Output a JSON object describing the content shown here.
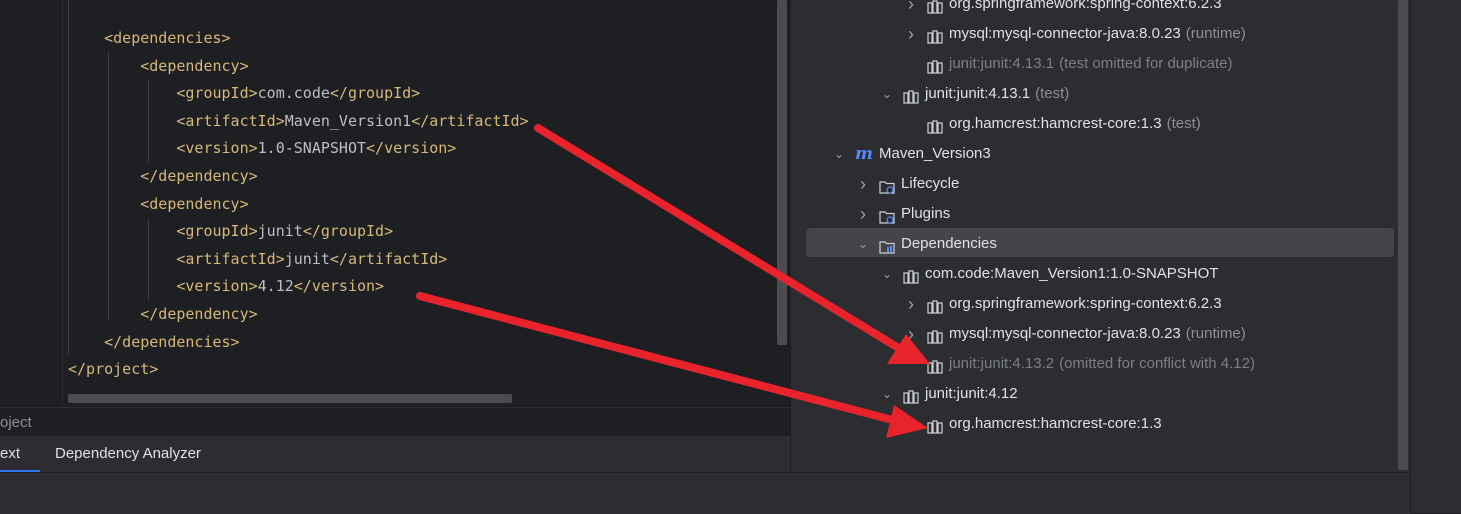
{
  "editor": {
    "lines": [
      {
        "indent": "    ",
        "parts": [
          [
            "tag",
            "<dependencies>"
          ]
        ]
      },
      {
        "indent": "        ",
        "parts": [
          [
            "tag",
            "<dependency>"
          ]
        ]
      },
      {
        "indent": "            ",
        "parts": [
          [
            "tag",
            "<groupId>"
          ],
          [
            "txt",
            "com.code"
          ],
          [
            "tag",
            "</groupId>"
          ]
        ]
      },
      {
        "indent": "            ",
        "parts": [
          [
            "tag",
            "<artifactId>"
          ],
          [
            "txt",
            "Maven_Version1"
          ],
          [
            "tag",
            "</artifactId>"
          ]
        ]
      },
      {
        "indent": "            ",
        "parts": [
          [
            "tag",
            "<version>"
          ],
          [
            "txt",
            "1.0-SNAPSHOT"
          ],
          [
            "tag",
            "</version>"
          ]
        ]
      },
      {
        "indent": "        ",
        "parts": [
          [
            "tag",
            "</dependency>"
          ]
        ]
      },
      {
        "indent": "        ",
        "parts": [
          [
            "tag",
            "<dependency>"
          ]
        ]
      },
      {
        "indent": "            ",
        "parts": [
          [
            "tag",
            "<groupId>"
          ],
          [
            "txt",
            "junit"
          ],
          [
            "tag",
            "</groupId>"
          ]
        ]
      },
      {
        "indent": "            ",
        "parts": [
          [
            "tag",
            "<artifactId>"
          ],
          [
            "txt",
            "junit"
          ],
          [
            "tag",
            "</artifactId>"
          ]
        ]
      },
      {
        "indent": "            ",
        "parts": [
          [
            "tag",
            "<version>"
          ],
          [
            "txt",
            "4.12"
          ],
          [
            "tag",
            "</version>"
          ]
        ]
      },
      {
        "indent": "        ",
        "parts": [
          [
            "tag",
            "</dependency>"
          ]
        ]
      },
      {
        "indent": "    ",
        "parts": [
          [
            "tag",
            "</dependencies>"
          ]
        ]
      },
      {
        "indent": "",
        "parts": [
          [
            "tag",
            "</project>"
          ]
        ]
      }
    ]
  },
  "breadcrumb": {
    "text": "oject"
  },
  "tabs": [
    {
      "label": "ext",
      "active": true
    },
    {
      "label": "Dependency Analyzer",
      "active": false
    }
  ],
  "tree": {
    "rows": [
      {
        "level": 3,
        "chevron": "right",
        "icon": "library-icon",
        "label": "org.springframework:spring-context:6.2.3",
        "note": "",
        "dim": false
      },
      {
        "level": 3,
        "chevron": "right",
        "icon": "library-icon",
        "label": "mysql:mysql-connector-java:8.0.23",
        "note": "(runtime)",
        "dim": false
      },
      {
        "level": 3,
        "chevron": "",
        "icon": "library-icon",
        "label": "junit:junit:4.13.1",
        "note": "(test omitted for duplicate)",
        "dim": true
      },
      {
        "level": 2,
        "chevron": "down",
        "icon": "library-icon",
        "label": "junit:junit:4.13.1",
        "note": "(test)",
        "dim": false
      },
      {
        "level": 3,
        "chevron": "",
        "icon": "library-icon",
        "label": "org.hamcrest:hamcrest-core:1.3",
        "note": "(test)",
        "dim": false
      },
      {
        "level": 0,
        "chevron": "down",
        "icon": "maven-icon",
        "label": "Maven_Version3",
        "note": "",
        "dim": false
      },
      {
        "level": 1,
        "chevron": "right",
        "icon": "lifecycle-folder-icon",
        "label": "Lifecycle",
        "note": "",
        "dim": false
      },
      {
        "level": 1,
        "chevron": "right",
        "icon": "plugins-folder-icon",
        "label": "Plugins",
        "note": "",
        "dim": false
      },
      {
        "level": 1,
        "chevron": "down",
        "icon": "dependencies-folder-icon",
        "label": "Dependencies",
        "note": "",
        "dim": false,
        "selected": true
      },
      {
        "level": 2,
        "chevron": "down",
        "icon": "library-icon",
        "label": "com.code:Maven_Version1:1.0-SNAPSHOT",
        "note": "",
        "dim": false
      },
      {
        "level": 3,
        "chevron": "right",
        "icon": "library-icon",
        "label": "org.springframework:spring-context:6.2.3",
        "note": "",
        "dim": false
      },
      {
        "level": 3,
        "chevron": "right",
        "icon": "library-icon",
        "label": "mysql:mysql-connector-java:8.0.23",
        "note": "(runtime)",
        "dim": false
      },
      {
        "level": 3,
        "chevron": "",
        "icon": "library-icon",
        "label": "junit:junit:4.13.2",
        "note": "(omitted for conflict with 4.12)",
        "dim": true
      },
      {
        "level": 2,
        "chevron": "down",
        "icon": "library-icon",
        "label": "junit:junit:4.12",
        "note": "",
        "dim": false
      },
      {
        "level": 3,
        "chevron": "",
        "icon": "library-icon",
        "label": "org.hamcrest:hamcrest-core:1.3",
        "note": "",
        "dim": false
      }
    ]
  },
  "colors": {
    "arrow": "#e8232b",
    "accent": "#3574f0",
    "tag": "#d5b778"
  }
}
